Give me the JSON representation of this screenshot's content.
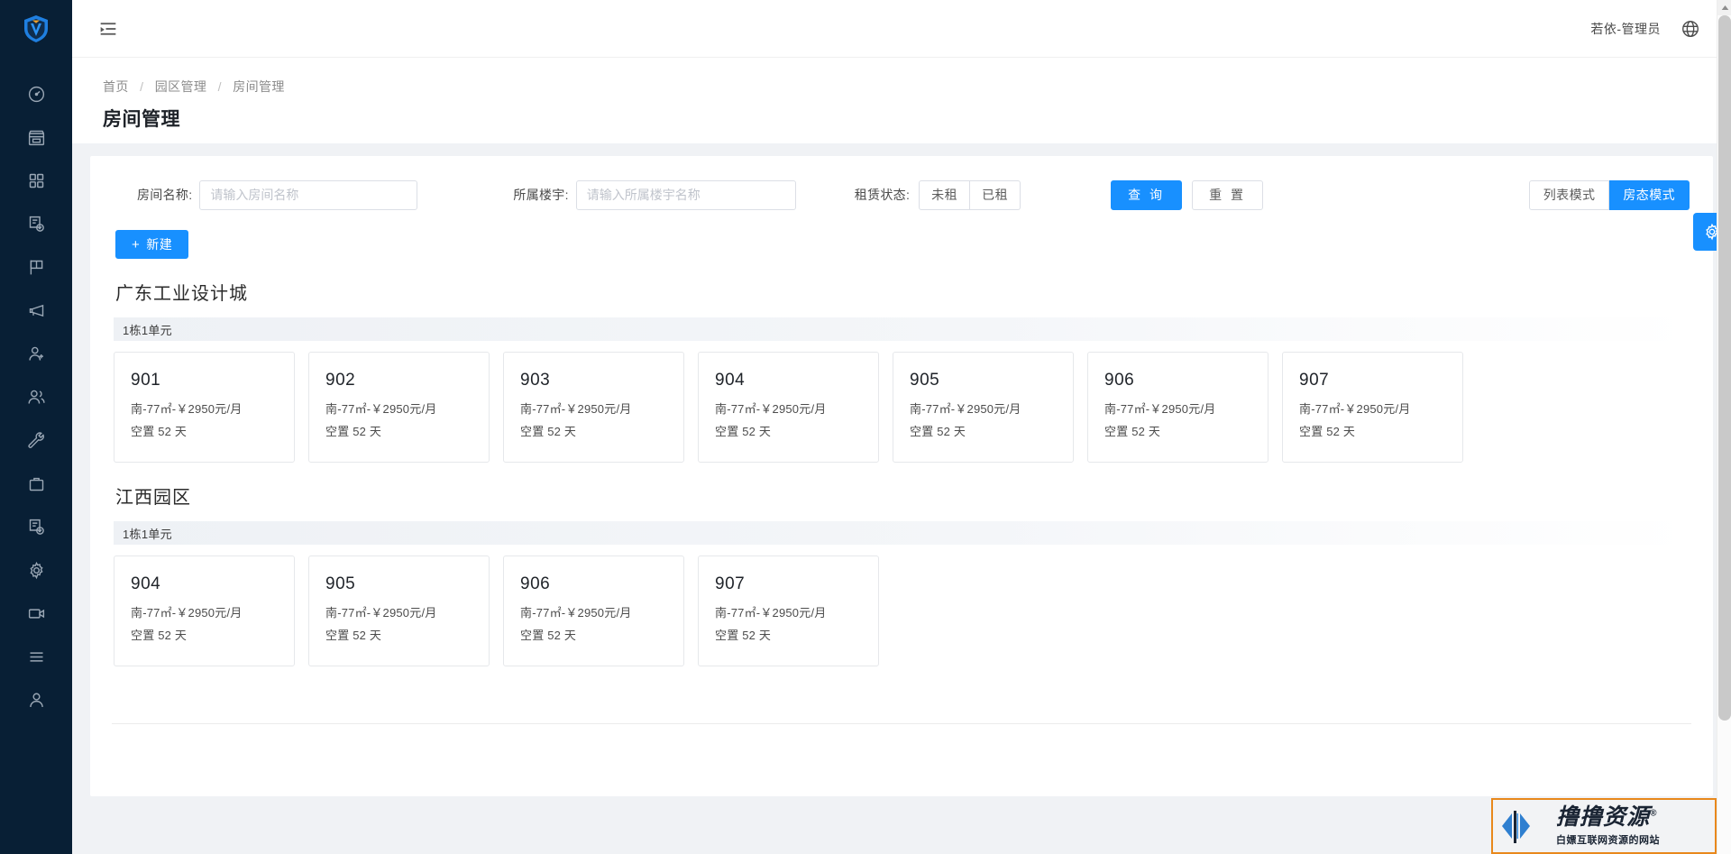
{
  "colors": {
    "accent": "#1890ff",
    "sidebar_bg": "#081f35",
    "page_bg": "#f0f2f5",
    "watermark_border": "#e8881c"
  },
  "sidebar": {
    "logo_name": "shield-logo",
    "items": [
      {
        "icon": "dashboard-icon",
        "name": "sidebar-item-dashboard"
      },
      {
        "icon": "store-icon",
        "name": "sidebar-item-store"
      },
      {
        "icon": "apps-grid-icon",
        "name": "sidebar-item-apps"
      },
      {
        "icon": "audit-doc-icon",
        "name": "sidebar-item-audit"
      },
      {
        "icon": "flag-icon",
        "name": "sidebar-item-flag"
      },
      {
        "icon": "megaphone-icon",
        "name": "sidebar-item-announcement"
      },
      {
        "icon": "user-add-icon",
        "name": "sidebar-item-user-add"
      },
      {
        "icon": "users-icon",
        "name": "sidebar-item-users"
      },
      {
        "icon": "wrench-icon",
        "name": "sidebar-item-maintenance"
      },
      {
        "icon": "briefcase-icon",
        "name": "sidebar-item-work"
      },
      {
        "icon": "audit-doc-icon",
        "name": "sidebar-item-review"
      },
      {
        "icon": "gear-icon",
        "name": "sidebar-item-settings"
      },
      {
        "icon": "video-icon",
        "name": "sidebar-item-video"
      },
      {
        "icon": "list-icon",
        "name": "sidebar-item-list"
      },
      {
        "icon": "person-icon",
        "name": "sidebar-item-profile"
      }
    ]
  },
  "topbar": {
    "collapse_icon": "menu-unfold-icon",
    "user_name": "若依-管理员",
    "lang_icon": "globe-icon"
  },
  "breadcrumb": {
    "items": [
      "首页",
      "园区管理",
      "房间管理"
    ],
    "separator": "/"
  },
  "page": {
    "title": "房间管理"
  },
  "filters": {
    "room_label": "房间名称:",
    "room_placeholder": "请输入房间名称",
    "room_value": "",
    "building_label": "所属楼宇:",
    "building_placeholder": "请输入所属楼宇名称",
    "building_value": "",
    "status_label": "租赁状态:",
    "status_options": [
      "未租",
      "已租"
    ],
    "status_selected": "",
    "query_label": "查 询",
    "reset_label": "重 置"
  },
  "view_mode": {
    "options": [
      "列表模式",
      "房态模式"
    ],
    "selected": "房态模式"
  },
  "actions": {
    "new_label": "新建",
    "new_plus": "+"
  },
  "float_button": {
    "icon": "gear-icon"
  },
  "parks": [
    {
      "name": "广东工业设计城",
      "units": [
        {
          "label": "1栋1单元",
          "rooms": [
            {
              "no": "901",
              "spec": "南-77㎡-￥2950元/月",
              "status": "空置 52 天"
            },
            {
              "no": "902",
              "spec": "南-77㎡-￥2950元/月",
              "status": "空置 52 天"
            },
            {
              "no": "903",
              "spec": "南-77㎡-￥2950元/月",
              "status": "空置 52 天"
            },
            {
              "no": "904",
              "spec": "南-77㎡-￥2950元/月",
              "status": "空置 52 天"
            },
            {
              "no": "905",
              "spec": "南-77㎡-￥2950元/月",
              "status": "空置 52 天"
            },
            {
              "no": "906",
              "spec": "南-77㎡-￥2950元/月",
              "status": "空置 52 天"
            },
            {
              "no": "907",
              "spec": "南-77㎡-￥2950元/月",
              "status": "空置 52 天"
            }
          ]
        }
      ]
    },
    {
      "name": "江西园区",
      "units": [
        {
          "label": "1栋1单元",
          "rooms": [
            {
              "no": "904",
              "spec": "南-77㎡-￥2950元/月",
              "status": "空置 52 天"
            },
            {
              "no": "905",
              "spec": "南-77㎡-￥2950元/月",
              "status": "空置 52 天"
            },
            {
              "no": "906",
              "spec": "南-77㎡-￥2950元/月",
              "status": "空置 52 天"
            },
            {
              "no": "907",
              "spec": "南-77㎡-￥2950元/月",
              "status": "空置 52 天"
            }
          ]
        }
      ]
    }
  ],
  "watermark": {
    "title": "撸撸资源",
    "registered": "®",
    "subtitle": "白嫖互联网资源的网站"
  }
}
